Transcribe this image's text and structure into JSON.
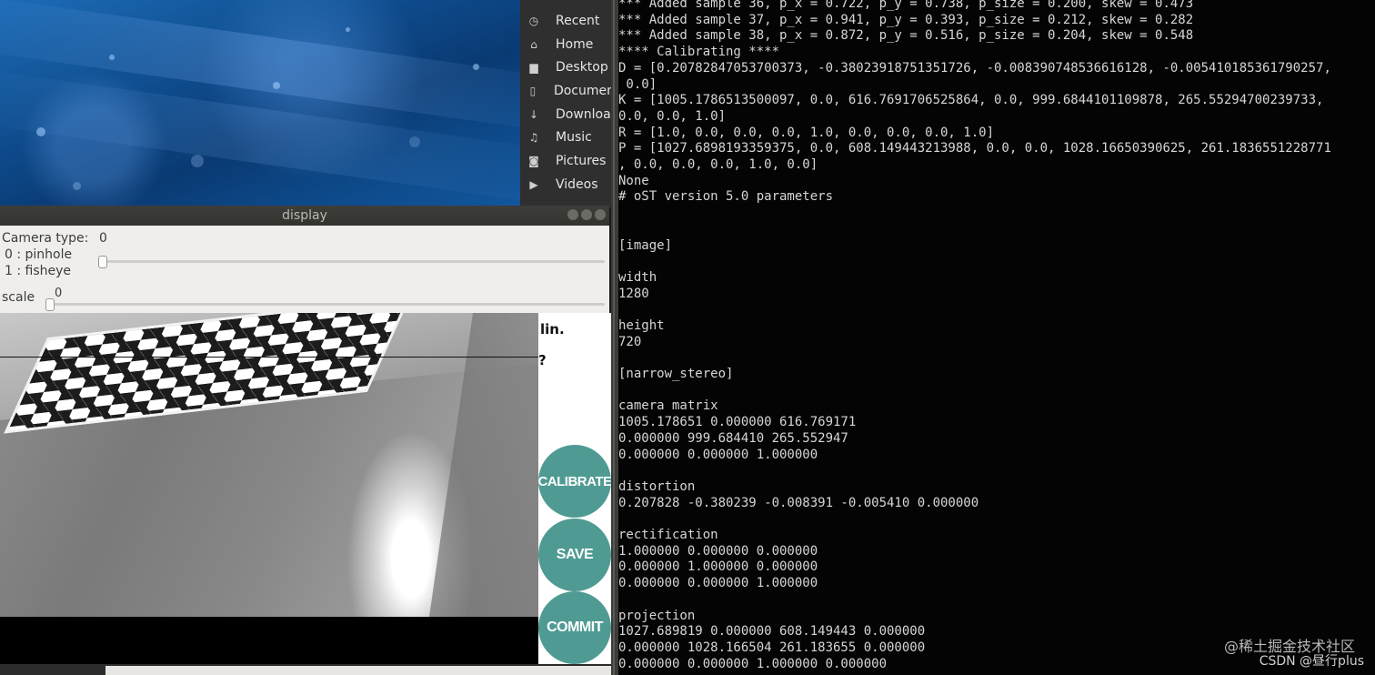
{
  "file_manager": {
    "items": [
      {
        "label": "Recent",
        "icon": "clock-icon"
      },
      {
        "label": "Home",
        "icon": "home-icon"
      },
      {
        "label": "Desktop",
        "icon": "folder-icon"
      },
      {
        "label": "Documen",
        "icon": "document-icon"
      },
      {
        "label": "Downloa",
        "icon": "download-icon"
      },
      {
        "label": "Music",
        "icon": "music-icon"
      },
      {
        "label": "Pictures",
        "icon": "camera-icon"
      },
      {
        "label": "Videos",
        "icon": "video-icon"
      }
    ]
  },
  "display_window": {
    "title": "display",
    "camera_type": {
      "label": "Camera type:",
      "value": "0",
      "option0": "0 : pinhole",
      "option1": "1 : fisheye"
    },
    "scale": {
      "label": "scale",
      "value": "0"
    },
    "side_text": {
      "lin": "lin.",
      "q": "?"
    },
    "buttons": {
      "calibrate": "CALIBRATE",
      "save": "SAVE",
      "commit": "COMMIT"
    },
    "colors": {
      "button": "#4f9b93"
    }
  },
  "terminal": {
    "lines": [
      "*** Added sample 36, p_x = 0.722, p_y = 0.738, p_size = 0.200, skew = 0.473",
      "*** Added sample 37, p_x = 0.941, p_y = 0.393, p_size = 0.212, skew = 0.282",
      "*** Added sample 38, p_x = 0.872, p_y = 0.516, p_size = 0.204, skew = 0.548",
      "**** Calibrating ****",
      "D = [0.20782847053700373, -0.38023918751351726, -0.008390748536616128, -0.005410185361790257,",
      " 0.0]",
      "K = [1005.1786513500097, 0.0, 616.7691706525864, 0.0, 999.6844101109878, 265.55294700239733,",
      "0.0, 0.0, 1.0]",
      "R = [1.0, 0.0, 0.0, 0.0, 1.0, 0.0, 0.0, 0.0, 1.0]",
      "P = [1027.6898193359375, 0.0, 608.149443213988, 0.0, 0.0, 1028.16650390625, 261.1836551228771",
      ", 0.0, 0.0, 0.0, 1.0, 0.0]",
      "None",
      "# oST version 5.0 parameters",
      "",
      "",
      "[image]",
      "",
      "width",
      "1280",
      "",
      "height",
      "720",
      "",
      "[narrow_stereo]",
      "",
      "camera matrix",
      "1005.178651 0.000000 616.769171",
      "0.000000 999.684410 265.552947",
      "0.000000 0.000000 1.000000",
      "",
      "distortion",
      "0.207828 -0.380239 -0.008391 -0.005410 0.000000",
      "",
      "rectification",
      "1.000000 0.000000 0.000000",
      "0.000000 1.000000 0.000000",
      "0.000000 0.000000 1.000000",
      "",
      "projection",
      "1027.689819 0.000000 608.149443 0.000000",
      "0.000000 1028.166504 261.183655 0.000000",
      "0.000000 0.000000 1.000000 0.000000"
    ]
  },
  "watermark": {
    "line1": "@稀土掘金技术社区",
    "line2": "CSDN @昼行plus"
  }
}
